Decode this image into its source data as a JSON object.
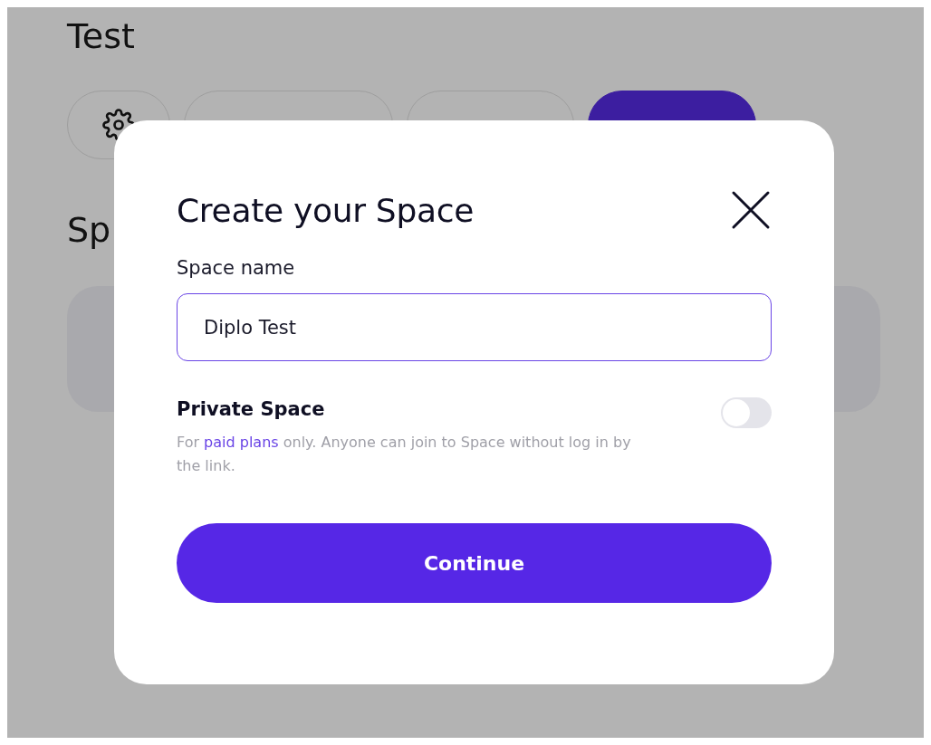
{
  "background": {
    "title": "Test",
    "pill_buttons": [
      {
        "kind": "gear"
      },
      {
        "kind": "outline"
      },
      {
        "kind": "outline"
      },
      {
        "kind": "primary"
      }
    ],
    "section_heading": "Sp"
  },
  "dialog": {
    "title": "Create your Space",
    "field": {
      "label": "Space name",
      "value": "Diplo Test",
      "focused": true
    },
    "private_toggle": {
      "label": "Private Space",
      "on": false,
      "description": [
        {
          "kind": "text",
          "text": "For "
        },
        {
          "kind": "link",
          "text": "paid plans"
        },
        {
          "kind": "text",
          "text": " only. Anyone can join to Space without log in by the link."
        }
      ]
    },
    "continue_button": "Continue"
  }
}
